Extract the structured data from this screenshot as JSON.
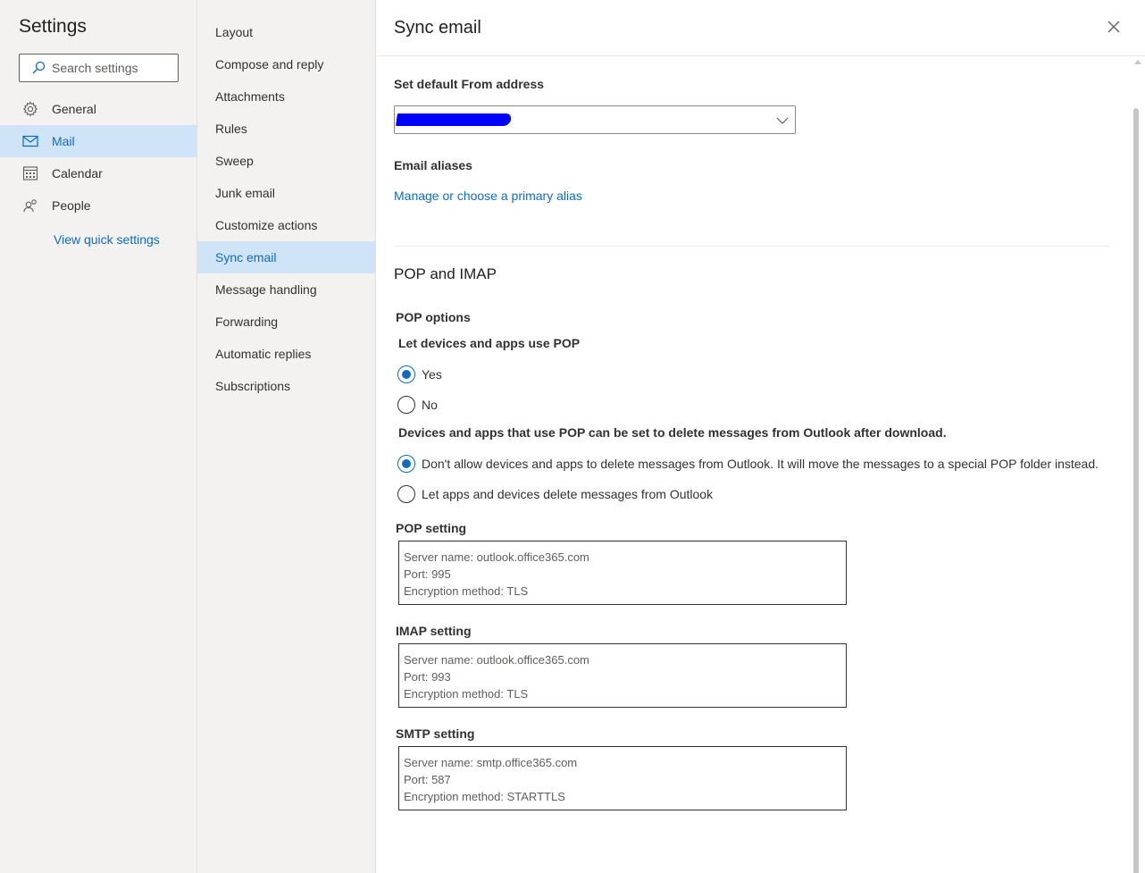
{
  "settings_title": "Settings",
  "search": {
    "placeholder": "Search settings"
  },
  "nav1": {
    "items": [
      {
        "label": "General",
        "icon": "gear-icon"
      },
      {
        "label": "Mail",
        "icon": "mail-icon",
        "active": true
      },
      {
        "label": "Calendar",
        "icon": "calendar-icon"
      },
      {
        "label": "People",
        "icon": "people-icon"
      }
    ],
    "quick_settings": "View quick settings"
  },
  "nav2": {
    "items": [
      "Layout",
      "Compose and reply",
      "Attachments",
      "Rules",
      "Sweep",
      "Junk email",
      "Customize actions",
      "Sync email",
      "Message handling",
      "Forwarding",
      "Automatic replies",
      "Subscriptions"
    ],
    "active": "Sync email"
  },
  "main": {
    "title": "Sync email",
    "from_label": "Set default From address",
    "aliases_label": "Email aliases",
    "aliases_link": "Manage or choose a primary alias",
    "pop_imap_title": "POP and IMAP",
    "pop_options_label": "POP options",
    "pop_allow_label": "Let devices and apps use POP",
    "pop_yes": "Yes",
    "pop_no": "No",
    "pop_allow_value": "Yes",
    "delete_label": "Devices and apps that use POP can be set to delete messages from Outlook after download.",
    "delete_opt1": "Don't allow devices and apps to delete messages from Outlook. It will move the messages to a special POP folder instead.",
    "delete_opt2": "Let apps and devices delete messages from Outlook",
    "pop_setting_label": "POP setting",
    "pop_setting": {
      "server": "Server name: outlook.office365.com",
      "port": "Port: 995",
      "encryption": "Encryption method: TLS"
    },
    "imap_setting_label": "IMAP setting",
    "imap_setting": {
      "server": "Server name: outlook.office365.com",
      "port": "Port: 993",
      "encryption": "Encryption method: TLS"
    },
    "smtp_setting_label": "SMTP setting",
    "smtp_setting": {
      "server": "Server name: smtp.office365.com",
      "port": "Port: 587",
      "encryption": "Encryption method: STARTTLS"
    }
  },
  "colors": {
    "accent": "#0f6cbd",
    "active_bg": "#cfe4f7",
    "nav_bg": "#f3f2f1",
    "redaction": "#0000ff"
  }
}
